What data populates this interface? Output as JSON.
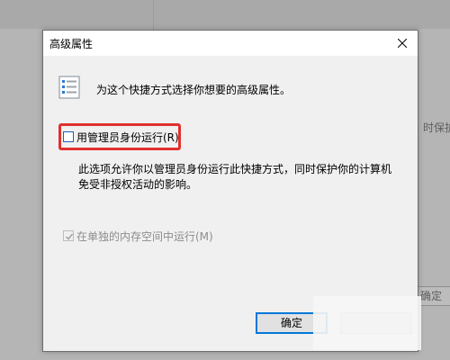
{
  "dialog": {
    "title": "高级属性",
    "header_text": "为这个快捷方式选择你想要的高级属性。",
    "run_as_admin": {
      "label": "用管理员身份运行(R)",
      "checked": false
    },
    "description_lines": [
      "此选项允许你以管理员身份运行此快捷方式，同时保护你的计算机",
      "免受非授权活动的影响。"
    ],
    "separate_memory": {
      "label": "在单独的内存空间中运行(M)",
      "checked": true,
      "enabled": false
    },
    "ok_label": "确定",
    "cancel_label": ""
  },
  "background": {
    "right_text_fragment": "时保护",
    "right_button_fragment": "确定"
  },
  "colors": {
    "highlight": "#e0312f",
    "focus_border": "#0078d7",
    "dialog_bg": "#f0f0f0"
  },
  "icons": {
    "header": "checklist-icon",
    "close": "close-icon",
    "check": "checkmark-icon"
  }
}
